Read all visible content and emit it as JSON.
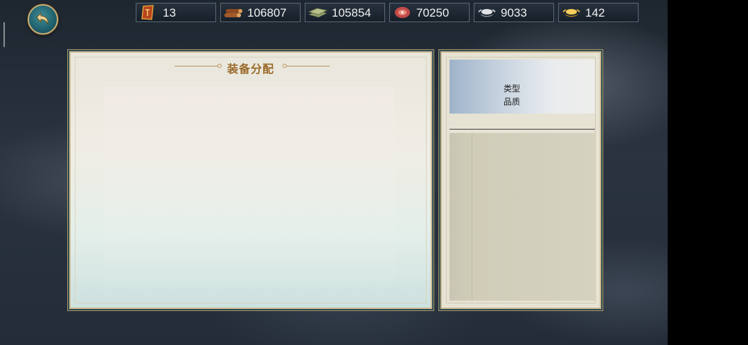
{
  "resources": [
    {
      "icon": "token-icon",
      "value": "13"
    },
    {
      "icon": "wood-icon",
      "value": "106807"
    },
    {
      "icon": "stone-icon",
      "value": "105854"
    },
    {
      "icon": "meat-icon",
      "value": "70250"
    },
    {
      "icon": "silver-ingot-icon",
      "value": "9033"
    },
    {
      "icon": "gold-ingot-icon",
      "value": "142"
    }
  ],
  "left_panel": {
    "title": "装备分配"
  },
  "right_panel": {
    "filter_type": "类型",
    "filter_quality": "品质"
  },
  "colors": {
    "title": "#9a6a2a",
    "frame_gold": "#cbb98f",
    "frame_teal": "#2e4b52"
  }
}
